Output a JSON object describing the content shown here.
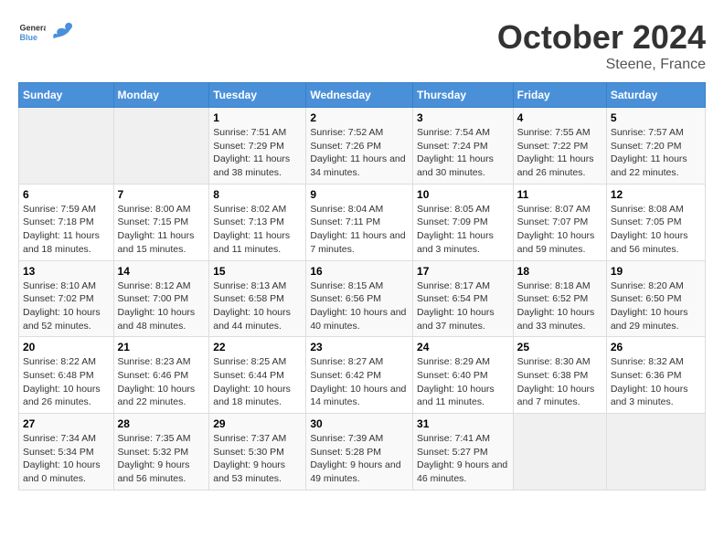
{
  "header": {
    "logo_general": "General",
    "logo_blue": "Blue",
    "month_title": "October 2024",
    "location": "Steene, France"
  },
  "days_of_week": [
    "Sunday",
    "Monday",
    "Tuesday",
    "Wednesday",
    "Thursday",
    "Friday",
    "Saturday"
  ],
  "weeks": [
    [
      {
        "day": "",
        "info": ""
      },
      {
        "day": "",
        "info": ""
      },
      {
        "day": "1",
        "info": "Sunrise: 7:51 AM\nSunset: 7:29 PM\nDaylight: 11 hours and 38 minutes."
      },
      {
        "day": "2",
        "info": "Sunrise: 7:52 AM\nSunset: 7:26 PM\nDaylight: 11 hours and 34 minutes."
      },
      {
        "day": "3",
        "info": "Sunrise: 7:54 AM\nSunset: 7:24 PM\nDaylight: 11 hours and 30 minutes."
      },
      {
        "day": "4",
        "info": "Sunrise: 7:55 AM\nSunset: 7:22 PM\nDaylight: 11 hours and 26 minutes."
      },
      {
        "day": "5",
        "info": "Sunrise: 7:57 AM\nSunset: 7:20 PM\nDaylight: 11 hours and 22 minutes."
      }
    ],
    [
      {
        "day": "6",
        "info": "Sunrise: 7:59 AM\nSunset: 7:18 PM\nDaylight: 11 hours and 18 minutes."
      },
      {
        "day": "7",
        "info": "Sunrise: 8:00 AM\nSunset: 7:15 PM\nDaylight: 11 hours and 15 minutes."
      },
      {
        "day": "8",
        "info": "Sunrise: 8:02 AM\nSunset: 7:13 PM\nDaylight: 11 hours and 11 minutes."
      },
      {
        "day": "9",
        "info": "Sunrise: 8:04 AM\nSunset: 7:11 PM\nDaylight: 11 hours and 7 minutes."
      },
      {
        "day": "10",
        "info": "Sunrise: 8:05 AM\nSunset: 7:09 PM\nDaylight: 11 hours and 3 minutes."
      },
      {
        "day": "11",
        "info": "Sunrise: 8:07 AM\nSunset: 7:07 PM\nDaylight: 10 hours and 59 minutes."
      },
      {
        "day": "12",
        "info": "Sunrise: 8:08 AM\nSunset: 7:05 PM\nDaylight: 10 hours and 56 minutes."
      }
    ],
    [
      {
        "day": "13",
        "info": "Sunrise: 8:10 AM\nSunset: 7:02 PM\nDaylight: 10 hours and 52 minutes."
      },
      {
        "day": "14",
        "info": "Sunrise: 8:12 AM\nSunset: 7:00 PM\nDaylight: 10 hours and 48 minutes."
      },
      {
        "day": "15",
        "info": "Sunrise: 8:13 AM\nSunset: 6:58 PM\nDaylight: 10 hours and 44 minutes."
      },
      {
        "day": "16",
        "info": "Sunrise: 8:15 AM\nSunset: 6:56 PM\nDaylight: 10 hours and 40 minutes."
      },
      {
        "day": "17",
        "info": "Sunrise: 8:17 AM\nSunset: 6:54 PM\nDaylight: 10 hours and 37 minutes."
      },
      {
        "day": "18",
        "info": "Sunrise: 8:18 AM\nSunset: 6:52 PM\nDaylight: 10 hours and 33 minutes."
      },
      {
        "day": "19",
        "info": "Sunrise: 8:20 AM\nSunset: 6:50 PM\nDaylight: 10 hours and 29 minutes."
      }
    ],
    [
      {
        "day": "20",
        "info": "Sunrise: 8:22 AM\nSunset: 6:48 PM\nDaylight: 10 hours and 26 minutes."
      },
      {
        "day": "21",
        "info": "Sunrise: 8:23 AM\nSunset: 6:46 PM\nDaylight: 10 hours and 22 minutes."
      },
      {
        "day": "22",
        "info": "Sunrise: 8:25 AM\nSunset: 6:44 PM\nDaylight: 10 hours and 18 minutes."
      },
      {
        "day": "23",
        "info": "Sunrise: 8:27 AM\nSunset: 6:42 PM\nDaylight: 10 hours and 14 minutes."
      },
      {
        "day": "24",
        "info": "Sunrise: 8:29 AM\nSunset: 6:40 PM\nDaylight: 10 hours and 11 minutes."
      },
      {
        "day": "25",
        "info": "Sunrise: 8:30 AM\nSunset: 6:38 PM\nDaylight: 10 hours and 7 minutes."
      },
      {
        "day": "26",
        "info": "Sunrise: 8:32 AM\nSunset: 6:36 PM\nDaylight: 10 hours and 3 minutes."
      }
    ],
    [
      {
        "day": "27",
        "info": "Sunrise: 7:34 AM\nSunset: 5:34 PM\nDaylight: 10 hours and 0 minutes."
      },
      {
        "day": "28",
        "info": "Sunrise: 7:35 AM\nSunset: 5:32 PM\nDaylight: 9 hours and 56 minutes."
      },
      {
        "day": "29",
        "info": "Sunrise: 7:37 AM\nSunset: 5:30 PM\nDaylight: 9 hours and 53 minutes."
      },
      {
        "day": "30",
        "info": "Sunrise: 7:39 AM\nSunset: 5:28 PM\nDaylight: 9 hours and 49 minutes."
      },
      {
        "day": "31",
        "info": "Sunrise: 7:41 AM\nSunset: 5:27 PM\nDaylight: 9 hours and 46 minutes."
      },
      {
        "day": "",
        "info": ""
      },
      {
        "day": "",
        "info": ""
      }
    ]
  ]
}
